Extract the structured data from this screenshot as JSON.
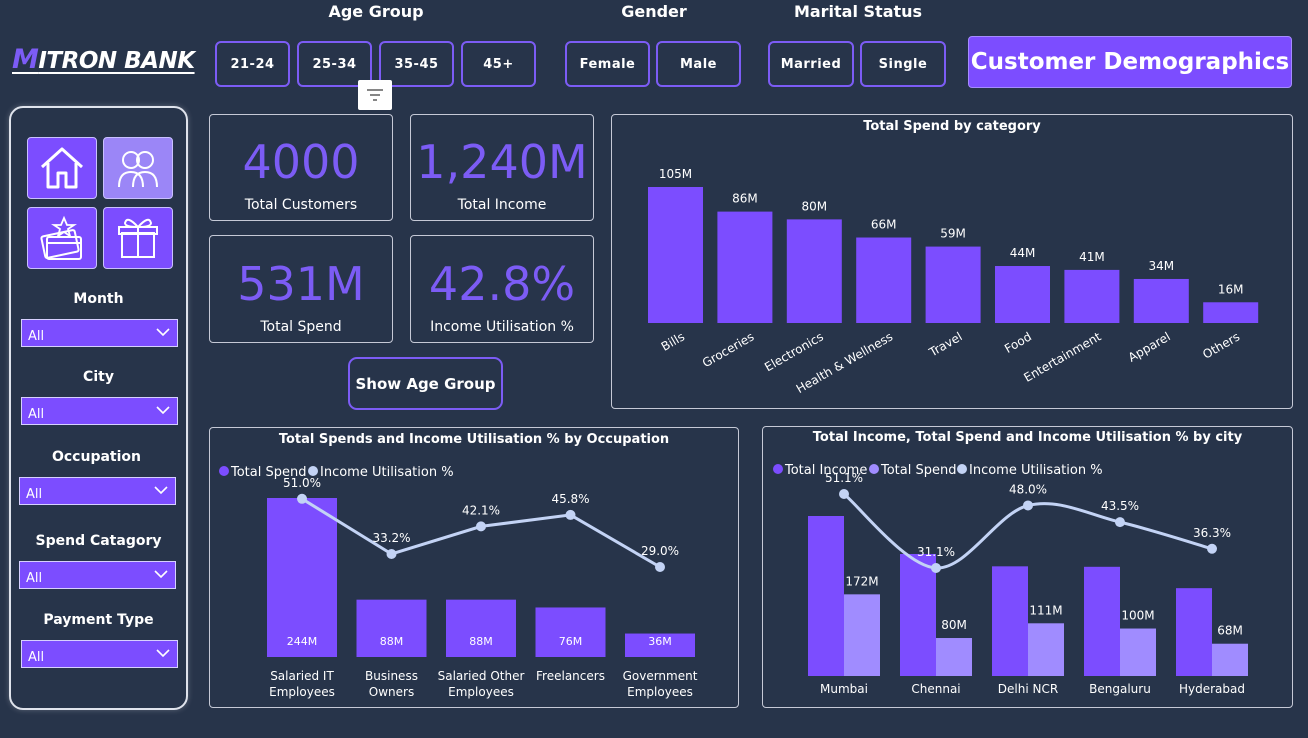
{
  "logo": {
    "first_letter": "M",
    "rest": "ITRON BANK"
  },
  "slicers": {
    "age_group": {
      "title": "Age Group",
      "options": [
        "21-24",
        "25-34",
        "35-45",
        "45+"
      ]
    },
    "gender": {
      "title": "Gender",
      "options": [
        "Female",
        "Male"
      ]
    },
    "marital_status": {
      "title": "Marital Status",
      "options": [
        "Married",
        "Single"
      ]
    }
  },
  "header_button": "Customer Demographics",
  "filter_icon": "filter-icon",
  "sidebar": {
    "nav": [
      {
        "icon": "home-icon"
      },
      {
        "icon": "users-icon"
      },
      {
        "icon": "credit-card-icon"
      },
      {
        "icon": "gift-icon"
      }
    ],
    "filters": [
      {
        "label": "Month",
        "value": "All"
      },
      {
        "label": "City",
        "value": "All"
      },
      {
        "label": "Occupation",
        "value": "All"
      },
      {
        "label": "Spend Catagory",
        "value": "All"
      },
      {
        "label": "Payment Type",
        "value": "All"
      }
    ]
  },
  "kpis": [
    {
      "value": "4000",
      "label": "Total Customers"
    },
    {
      "value": "1,240M",
      "label": "Total Income"
    },
    {
      "value": "531M",
      "label": "Total Spend"
    },
    {
      "value": "42.8%",
      "label": "Income Utilisation %"
    }
  ],
  "show_button": "Show Age Group",
  "colors": {
    "accent": "#7c4dff",
    "spend": "#7c4dff",
    "spend_light": "#a08cff",
    "line": "#c3d3f5",
    "background": "#27344a"
  },
  "chart_data": [
    {
      "type": "bar",
      "title": "Total Spend by category",
      "categories": [
        "Bills",
        "Groceries",
        "Electronics",
        "Health & Wellness",
        "Travel",
        "Food",
        "Entertainment",
        "Apparel",
        "Others"
      ],
      "values": [
        105,
        86,
        80,
        66,
        59,
        44,
        41,
        34,
        16
      ],
      "data_labels": [
        "105M",
        "86M",
        "80M",
        "66M",
        "59M",
        "44M",
        "41M",
        "34M",
        "16M"
      ],
      "unit": "M",
      "legend": "none",
      "grid": false
    },
    {
      "type": "bar",
      "title": "Total Spends and Income Utilisation % by Occupation",
      "legend_position": "top-left",
      "categories": [
        [
          "Salaried IT",
          "Employees"
        ],
        [
          "Business",
          "Owners"
        ],
        [
          "Salaried Other",
          "Employees"
        ],
        [
          "Freelancers"
        ],
        [
          "Government",
          "Employees"
        ]
      ],
      "series": [
        {
          "name": "Total Spend",
          "type": "bar",
          "values": [
            244,
            88,
            88,
            76,
            36
          ],
          "labels": [
            "244M",
            "88M",
            "88M",
            "76M",
            "36M"
          ]
        },
        {
          "name": "Income Utilisation %",
          "type": "line",
          "values": [
            51.0,
            33.2,
            42.1,
            45.8,
            29.0
          ],
          "labels": [
            "51.0%",
            "33.2%",
            "42.1%",
            "45.8%",
            "29.0%"
          ]
        }
      ]
    },
    {
      "type": "bar",
      "title": "Total Income, Total Spend and Income Utilisation % by city",
      "legend_position": "top-left",
      "categories": [
        "Mumbai",
        "Chennai",
        "Delhi NCR",
        "Bengaluru",
        "Hyderabad"
      ],
      "series": [
        {
          "name": "Total Income",
          "type": "bar",
          "values": [
            337,
            257,
            231,
            230,
            185
          ],
          "labels": []
        },
        {
          "name": "Total Spend",
          "type": "bar",
          "values": [
            172,
            80,
            111,
            100,
            68
          ],
          "labels": [
            "172M",
            "80M",
            "111M",
            "100M",
            "68M"
          ]
        },
        {
          "name": "Income Utilisation %",
          "type": "line",
          "values": [
            51.1,
            31.1,
            48.0,
            43.5,
            36.3
          ],
          "labels": [
            "51.1%",
            "31.1%",
            "48.0%",
            "43.5%",
            "36.3%"
          ]
        }
      ]
    }
  ]
}
